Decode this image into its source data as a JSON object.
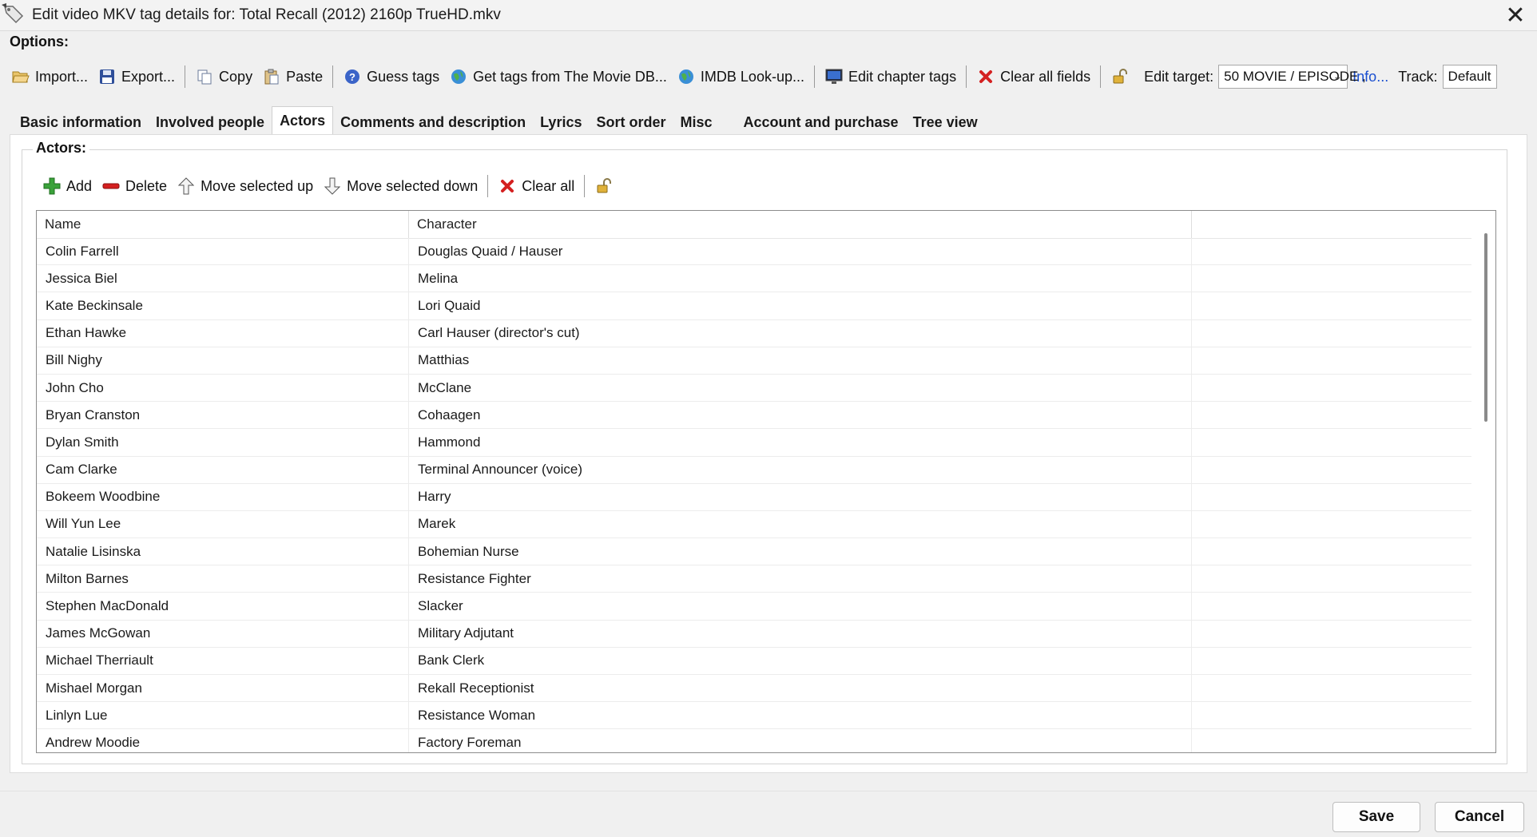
{
  "window": {
    "title": "Edit video MKV tag details for: Total Recall (2012) 2160p TrueHD.mkv",
    "close_glyph": "✕",
    "icon": "tag-icon"
  },
  "options_label": "Options:",
  "toolbar": {
    "import": "Import...",
    "export": "Export...",
    "copy": "Copy",
    "paste": "Paste",
    "guess_tags": "Guess tags",
    "get_tags_moviedb": "Get tags from The Movie DB...",
    "imdb_lookup": "IMDB Look-up...",
    "edit_chapter_tags": "Edit chapter tags",
    "clear_all_fields": "Clear all fields",
    "edit_target_label": "Edit target:",
    "edit_target_value": "50 MOVIE / EPISODE ,",
    "info_link": "Info...",
    "track_label": "Track:",
    "track_value": "Default"
  },
  "tabs": [
    {
      "label": "Basic information",
      "active": false
    },
    {
      "label": "Involved people",
      "active": false
    },
    {
      "label": "Actors",
      "active": true
    },
    {
      "label": "Comments and description",
      "active": false
    },
    {
      "label": "Lyrics",
      "active": false
    },
    {
      "label": "Sort order",
      "active": false
    },
    {
      "label": "Misc",
      "active": false
    },
    {
      "label": "Account and purchase",
      "active": false
    },
    {
      "label": "Tree view",
      "active": false
    }
  ],
  "actors_group": {
    "title": "Actors:",
    "actions": {
      "add": "Add",
      "delete": "Delete",
      "move_up": "Move selected up",
      "move_down": "Move selected down",
      "clear_all": "Clear all"
    },
    "columns": [
      "Name",
      "Character",
      ""
    ],
    "rows": [
      {
        "name": "Colin Farrell",
        "character": "Douglas Quaid / Hauser"
      },
      {
        "name": "Jessica Biel",
        "character": "Melina"
      },
      {
        "name": "Kate Beckinsale",
        "character": "Lori Quaid"
      },
      {
        "name": "Ethan Hawke",
        "character": "Carl Hauser (director's cut)"
      },
      {
        "name": "Bill Nighy",
        "character": "Matthias"
      },
      {
        "name": "John Cho",
        "character": "McClane"
      },
      {
        "name": "Bryan Cranston",
        "character": "Cohaagen"
      },
      {
        "name": "Dylan Smith",
        "character": "Hammond"
      },
      {
        "name": "Cam Clarke",
        "character": "Terminal Announcer (voice)"
      },
      {
        "name": "Bokeem Woodbine",
        "character": "Harry"
      },
      {
        "name": "Will Yun Lee",
        "character": "Marek"
      },
      {
        "name": "Natalie Lisinska",
        "character": "Bohemian Nurse"
      },
      {
        "name": "Milton Barnes",
        "character": "Resistance Fighter"
      },
      {
        "name": "Stephen MacDonald",
        "character": "Slacker"
      },
      {
        "name": "James McGowan",
        "character": "Military Adjutant"
      },
      {
        "name": "Michael Therriault",
        "character": "Bank Clerk"
      },
      {
        "name": "Mishael Morgan",
        "character": "Rekall Receptionist"
      },
      {
        "name": "Linlyn Lue",
        "character": "Resistance Woman"
      },
      {
        "name": "Andrew Moodie",
        "character": "Factory Foreman"
      }
    ]
  },
  "buttons": {
    "save": "Save",
    "cancel": "Cancel"
  },
  "colors": {
    "link": "#1a4fd0",
    "clear_red": "#d42020",
    "delete_red": "#d42020",
    "add_green": "#3aa23a"
  }
}
